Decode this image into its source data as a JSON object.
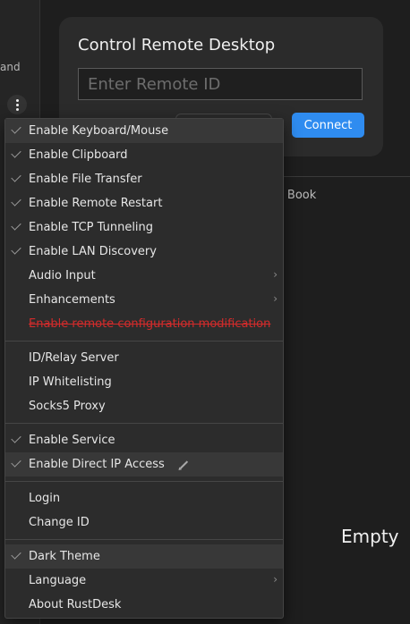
{
  "left": {
    "fragment": "and",
    "menu_icon": "more-vertical-icon"
  },
  "card": {
    "title": "Control Remote Desktop",
    "input_placeholder": "Enter Remote ID",
    "connect_label": "Connect"
  },
  "tabs": {
    "fragment": "s Book"
  },
  "empty_label": "Empty",
  "menu": {
    "groups": [
      [
        {
          "label": "Enable Keyboard/Mouse",
          "checked": true,
          "highlight": true
        },
        {
          "label": "Enable Clipboard",
          "checked": true
        },
        {
          "label": "Enable File Transfer",
          "checked": true
        },
        {
          "label": "Enable Remote Restart",
          "checked": true
        },
        {
          "label": "Enable TCP Tunneling",
          "checked": true
        },
        {
          "label": "Enable LAN Discovery",
          "checked": true
        },
        {
          "label": "Audio Input",
          "submenu": true
        },
        {
          "label": "Enhancements",
          "submenu": true
        },
        {
          "label": "Enable remote configuration modification",
          "danger": true
        }
      ],
      [
        {
          "label": "ID/Relay Server"
        },
        {
          "label": "IP Whitelisting"
        },
        {
          "label": "Socks5 Proxy"
        }
      ],
      [
        {
          "label": "Enable Service",
          "checked": true
        },
        {
          "label": "Enable Direct IP Access",
          "checked": true,
          "highlight": true,
          "edit": true
        }
      ],
      [
        {
          "label": "Login"
        },
        {
          "label": "Change ID"
        }
      ],
      [
        {
          "label": "Dark Theme",
          "checked": true,
          "highlight": true
        },
        {
          "label": "Language",
          "submenu": true
        },
        {
          "label": "About RustDesk"
        }
      ]
    ]
  }
}
